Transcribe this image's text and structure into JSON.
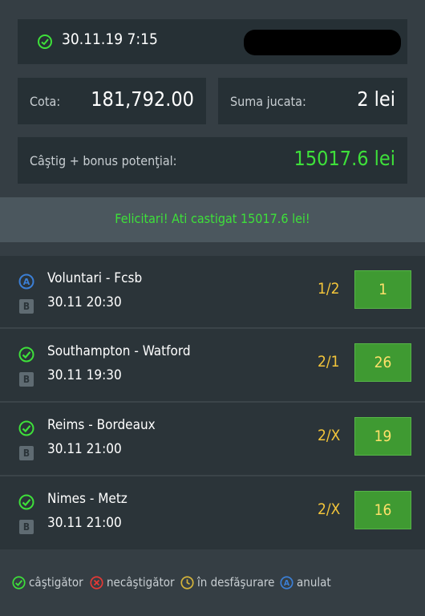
{
  "ticket": {
    "datetime": "30.11.19 7:15",
    "cota_label": "Cota:",
    "cota_value": "181,792.00",
    "suma_label": "Suma jucata:",
    "suma_value": "2 lei",
    "castig_label": "Câştig + bonus potenţial:",
    "castig_value": "15017.6 lei"
  },
  "banner": {
    "text": "Felicitari! Ati castigat 15017.6 lei!"
  },
  "matches": [
    {
      "status": "anulat",
      "badge": "B",
      "teams": "Voluntari - Fcsb",
      "time": "30.11 20:30",
      "pick": "1/2",
      "result": "1"
    },
    {
      "status": "castigator",
      "badge": "B",
      "teams": "Southampton - Watford",
      "time": "30.11 19:30",
      "pick": "2/1",
      "result": "26"
    },
    {
      "status": "castigator",
      "badge": "B",
      "teams": "Reims - Bordeaux",
      "time": "30.11 21:00",
      "pick": "2/X",
      "result": "19"
    },
    {
      "status": "castigator",
      "badge": "B",
      "teams": "Nimes - Metz",
      "time": "30.11 21:00",
      "pick": "2/X",
      "result": "16"
    }
  ],
  "legend": {
    "castigator": "câştigător",
    "necastigator": "necâştigător",
    "in_desfasurare": "în desfăşurare",
    "anulat": "anulat"
  },
  "colors": {
    "win": "#3ee03a",
    "pick": "#f3c53a",
    "odds_box": "#3f9a32",
    "annulled": "#3b7fd6",
    "lost": "#e53935",
    "pending": "#d4b33a"
  }
}
